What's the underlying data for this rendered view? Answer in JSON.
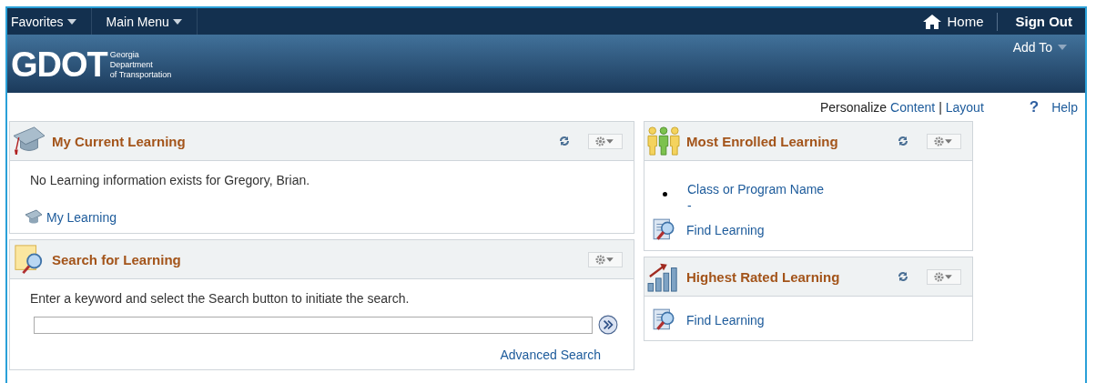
{
  "nav": {
    "menus": [
      {
        "label": "Favorites"
      },
      {
        "label": "Main Menu"
      }
    ],
    "home": "Home",
    "sign_out": "Sign Out",
    "add_to": "Add To"
  },
  "logo": {
    "letters": "GDOT",
    "name_lines": [
      "Georgia",
      "Department",
      "of Transportation"
    ]
  },
  "personalize": {
    "label": "Personalize",
    "links": [
      "Content",
      "Layout"
    ],
    "separator": "|",
    "help_mark": "?",
    "help": "Help"
  },
  "columns": [
    {
      "pagelets": [
        {
          "kind": "cap",
          "title": "My Current Learning",
          "refresh": true,
          "body": [
            {
              "kind": "message",
              "text": "No Learning information exists for Gregory, Brian."
            },
            {
              "kind": "cap_link",
              "text": "My Learning"
            }
          ]
        },
        {
          "kind": "search",
          "title": "Search for Learning",
          "refresh": false,
          "body": [
            {
              "kind": "message",
              "text": "Enter a keyword and select the Search button to initiate the search."
            },
            {
              "kind": "search"
            },
            {
              "kind": "right_link",
              "text": "Advanced Search"
            }
          ]
        }
      ]
    },
    {
      "pagelets": [
        {
          "kind": "people",
          "title": "Most Enrolled Learning",
          "refresh": true,
          "body": [
            {
              "kind": "bullet",
              "text": "Class or Program Name",
              "sub": "-"
            },
            {
              "kind": "find_link",
              "text": "Find Learning"
            }
          ]
        },
        {
          "kind": "chart",
          "title": "Highest Rated Learning",
          "refresh": true,
          "body": [
            {
              "kind": "find_link",
              "text": "Find Learning"
            }
          ]
        }
      ]
    }
  ]
}
